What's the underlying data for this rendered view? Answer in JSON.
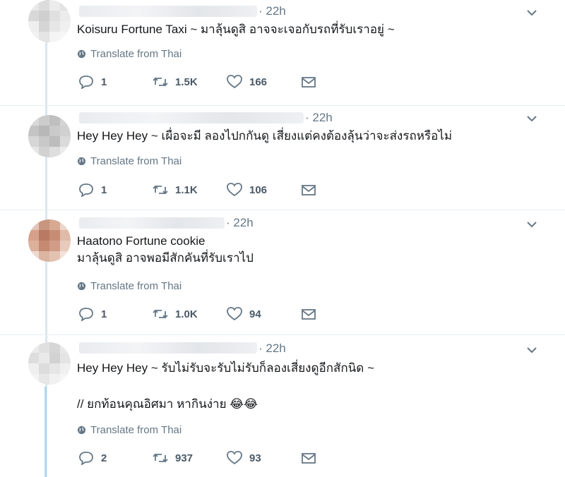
{
  "colors": {
    "text": "#14171a",
    "muted": "#657786",
    "thread": "#b5d8ee",
    "divider": "#e6ecf0"
  },
  "tweets": [
    {
      "time": "· 22h",
      "lines": [
        "Koisuru Fortune Taxi ~ มาลุ้นดูสิ อาจจะเจอกับรถที่รับเราอยู่ ~"
      ],
      "translate": "Translate from Thai",
      "replies": "1",
      "retweets": "1.5K",
      "likes": "166"
    },
    {
      "time": "· 22h",
      "lines": [
        "Hey Hey Hey ~ เผื่อจะมี ลองไปกกันดู เสี่ยงแต่คงต้องลุ้นว่าจะส่งรถหรือไม่"
      ],
      "translate": "Translate from Thai",
      "replies": "1",
      "retweets": "1.1K",
      "likes": "106"
    },
    {
      "time": "· 22h",
      "lines": [
        "Haatono Fortune cookie",
        "มาลุ้นดูสิ อาจพอมีสักคันที่รับเราไป"
      ],
      "translate": "Translate from Thai",
      "replies": "1",
      "retweets": "1.0K",
      "likes": "94"
    },
    {
      "time": "· 22h",
      "lines": [
        "Hey Hey Hey ~ รับไม่รับจะรับไม่รับก็ลองเสี่ยงดูอีกสักนิด ~",
        "// ยกท้อนคุณอิศมา หากินง่าย 😂😂"
      ],
      "translate": "Translate from Thai",
      "replies": "2",
      "retweets": "937",
      "likes": "93"
    }
  ],
  "icons": {
    "reply": "reply-icon",
    "retweet": "retweet-icon",
    "like": "heart-icon",
    "dm": "envelope-icon",
    "globe": "globe-icon",
    "more": "chevron-down-icon"
  }
}
